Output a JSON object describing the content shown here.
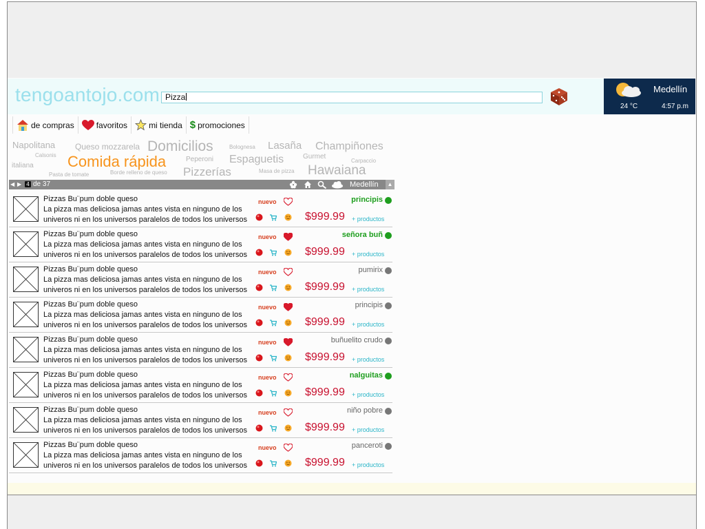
{
  "header": {
    "logo": "tengoantojo.com",
    "search_value": "Pizza"
  },
  "weather": {
    "city": "Medellín",
    "temperature": "24 °C",
    "time": "4:57 p.m",
    "icon": "partly-cloudy-icon"
  },
  "nav": [
    {
      "label": "de compras",
      "icon": "house-icon"
    },
    {
      "label": "favoritos",
      "icon": "heart-icon"
    },
    {
      "label": "mi tienda",
      "icon": "star-icon"
    },
    {
      "label": "promociones",
      "icon": "dollar-icon"
    }
  ],
  "tag_cloud": [
    {
      "text": "Napolitana"
    },
    {
      "text": "Queso mozzarela"
    },
    {
      "text": "Domicilios"
    },
    {
      "text": "Bolognesa"
    },
    {
      "text": "Lasaña"
    },
    {
      "text": "Champiñones"
    },
    {
      "text": "Calsonis"
    },
    {
      "text": "Comida rápida",
      "color": "#f7941d"
    },
    {
      "text": "Peperoni"
    },
    {
      "text": "Espaguetis"
    },
    {
      "text": "Gurmet"
    },
    {
      "text": "Carpaccio"
    },
    {
      "text": "italiana"
    },
    {
      "text": "Pasta de tomate"
    },
    {
      "text": "Borde relleno de queso"
    },
    {
      "text": "Pizzerías"
    },
    {
      "text": "Masa de pizza"
    },
    {
      "text": "Hawaiana"
    }
  ],
  "toolbar": {
    "page": "4",
    "of_label": "de 37",
    "city": "Medellín",
    "icons": [
      "flower-icon",
      "house-icon",
      "search-icon",
      "cloud-icon"
    ]
  },
  "listings": [
    {
      "title": "Pizzas Bu¨pum doble queso",
      "desc": "La pizza mas deliciosa jamas antes vista en ninguno de los univeros ni en los universos paralelos de todos los universos",
      "badge": "nuevo",
      "favorite": false,
      "price": "$999.99",
      "store": "principis",
      "store_active": true,
      "more": "+ productos"
    },
    {
      "title": "Pizzas Bu¨pum doble queso",
      "desc": "La pizza mas deliciosa jamas antes vista en ninguno de los univeros ni en los universos paralelos de todos los universos",
      "badge": "nuevo",
      "favorite": true,
      "price": "$999.99",
      "store": "señora buñ",
      "store_active": true,
      "more": "+ productos"
    },
    {
      "title": "Pizzas Bu¨pum doble queso",
      "desc": "La pizza mas deliciosa jamas antes vista en ninguno de los univeros ni en los universos paralelos de todos los universos",
      "badge": "nuevo",
      "favorite": false,
      "price": "$999.99",
      "store": "pumirix",
      "store_active": false,
      "more": "+ productos"
    },
    {
      "title": "Pizzas Bu¨pum doble queso",
      "desc": "La pizza mas deliciosa jamas antes vista en ninguno de los univeros ni en los universos paralelos de todos los universos",
      "badge": "nuevo",
      "favorite": true,
      "price": "$999.99",
      "store": "principis",
      "store_active": false,
      "more": "+ productos"
    },
    {
      "title": "Pizzas Bu¨pum doble queso",
      "desc": "La pizza mas deliciosa jamas antes vista en ninguno de los univeros ni en los universos paralelos de todos los universos",
      "badge": "nuevo",
      "favorite": true,
      "price": "$999.99",
      "store": "buñuelito crudo",
      "store_active": false,
      "more": "+ productos"
    },
    {
      "title": "Pizzas Bu¨pum doble queso",
      "desc": "La pizza mas deliciosa jamas antes vista en ninguno de los univeros ni en los universos paralelos de todos los universos",
      "badge": "nuevo",
      "favorite": false,
      "price": "$999.99",
      "store": "nalguitas",
      "store_active": true,
      "more": "+ productos"
    },
    {
      "title": "Pizzas Bu¨pum doble queso",
      "desc": "La pizza mas deliciosa jamas antes vista en ninguno de los univeros ni en los universos paralelos de todos los universos",
      "badge": "nuevo",
      "favorite": false,
      "price": "$999.99",
      "store": "niño pobre",
      "store_active": false,
      "more": "+ productos"
    },
    {
      "title": "Pizzas Bu¨pum doble queso",
      "desc": "La pizza mas deliciosa jamas antes vista en ninguno de los univeros ni en los universos paralelos de todos los universos",
      "badge": "nuevo",
      "favorite": false,
      "price": "$999.99",
      "store": "panceroti",
      "store_active": false,
      "more": "+ productos"
    }
  ],
  "colors": {
    "accent": "#9be0ec",
    "price": "#c8102e",
    "active_store": "#1e9e1e",
    "weather_bg": "#0d2a4c"
  }
}
